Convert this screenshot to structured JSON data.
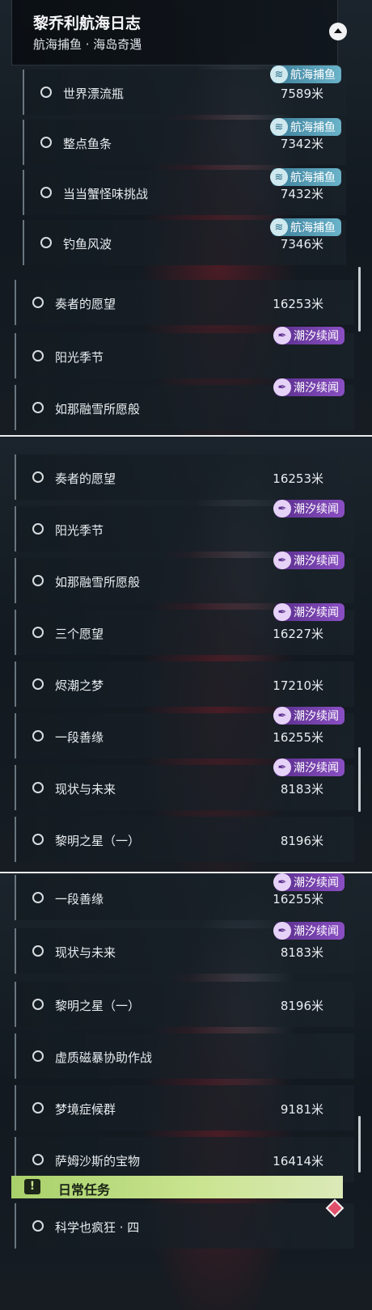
{
  "header": {
    "title": "黎乔利航海日志",
    "subtitle": "航海捕鱼 · 海岛奇遇"
  },
  "tags": {
    "fishing": "航海捕鱼",
    "tide": "潮汐续闻"
  },
  "icons": {
    "collapse": "chevron-up-icon",
    "fishing_tag": "wave-icon",
    "tide_tag": "feather-icon",
    "daily": "exclamation-icon"
  },
  "colors": {
    "fishing_tag": "#4f9ab3",
    "tide_tag": "#7a44b0",
    "daily_bar": "#b5da76",
    "marker": "#e0506a"
  },
  "screen1": {
    "rows": [
      {
        "label": "世界漂流瓶",
        "distance": "7589米",
        "tag": "航海捕鱼"
      },
      {
        "label": "整点鱼条",
        "distance": "7342米",
        "tag": "航海捕鱼"
      },
      {
        "label": "当当蟹怪味挑战",
        "distance": "7432米",
        "tag": "航海捕鱼"
      },
      {
        "label": "钓鱼风波",
        "distance": "7346米",
        "tag": "航海捕鱼"
      },
      {
        "label": "奏者的愿望",
        "distance": "16253米",
        "tag": ""
      },
      {
        "label": "阳光季节",
        "distance": "",
        "tag": "潮汐续闻"
      },
      {
        "label": "如那融雪所愿般",
        "distance": "",
        "tag": "潮汐续闻"
      }
    ]
  },
  "screen2": {
    "rows": [
      {
        "label": "奏者的愿望",
        "distance": "16253米",
        "tag": ""
      },
      {
        "label": "阳光季节",
        "distance": "",
        "tag": "潮汐续闻"
      },
      {
        "label": "如那融雪所愿般",
        "distance": "",
        "tag": "潮汐续闻"
      },
      {
        "label": "三个愿望",
        "distance": "16227米",
        "tag": "潮汐续闻"
      },
      {
        "label": "烬潮之梦",
        "distance": "17210米",
        "tag": ""
      },
      {
        "label": "一段善缘",
        "distance": "16255米",
        "tag": "潮汐续闻"
      },
      {
        "label": "现状与未来",
        "distance": "8183米",
        "tag": "潮汐续闻"
      },
      {
        "label": "黎明之星（一）",
        "distance": "8196米",
        "tag": ""
      }
    ]
  },
  "screen3": {
    "rows": [
      {
        "label": "一段善缘",
        "distance": "16255米",
        "tag": "潮汐续闻"
      },
      {
        "label": "现状与未来",
        "distance": "8183米",
        "tag": "潮汐续闻"
      },
      {
        "label": "黎明之星（一）",
        "distance": "8196米",
        "tag": ""
      },
      {
        "label": "虚质磁暴协助作战",
        "distance": "",
        "tag": ""
      },
      {
        "label": "梦境症候群",
        "distance": "9181米",
        "tag": ""
      },
      {
        "label": "萨姆沙斯的宝物",
        "distance": "16414米",
        "tag": ""
      }
    ],
    "daily_section": {
      "label": "日常任务",
      "icon_text": "!"
    },
    "daily_rows": [
      {
        "label": "科学也疯狂 · 四",
        "distance": "",
        "tag": ""
      }
    ]
  }
}
